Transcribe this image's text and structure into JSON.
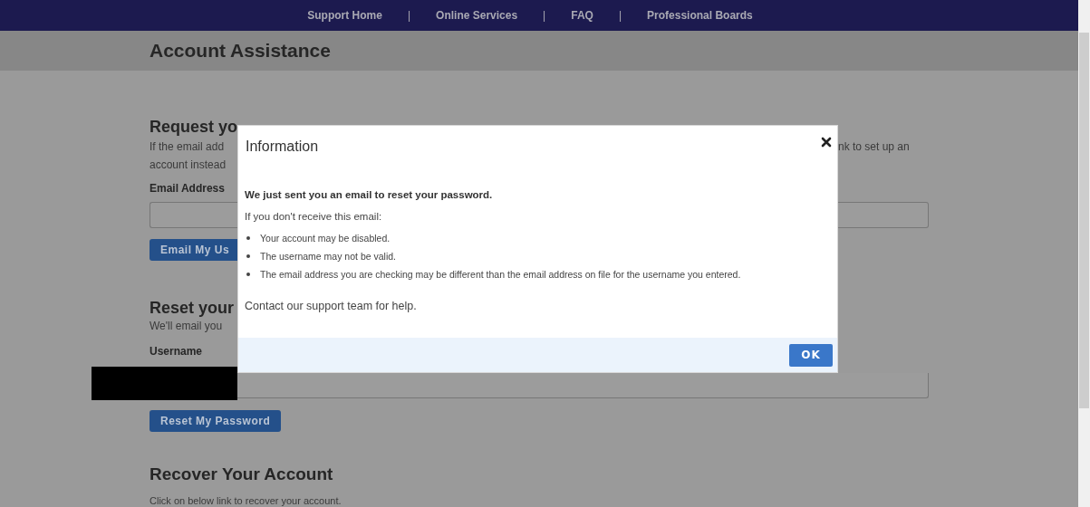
{
  "nav": [
    {
      "kind": "link",
      "label": "Support Home"
    },
    {
      "kind": "separator",
      "label": "|"
    },
    {
      "kind": "link",
      "label": "Online Services"
    },
    {
      "kind": "separator",
      "label": "|"
    },
    {
      "kind": "link",
      "label": "FAQ"
    },
    {
      "kind": "separator",
      "label": "|"
    },
    {
      "kind": "link",
      "label": "Professional Boards"
    }
  ],
  "page_title": "Account Assistance",
  "left_column": {
    "heading": "Request yo",
    "intro_lines": [
      "If the email add",
      "account instead"
    ],
    "email_label": "Email Address",
    "email_button": "Email My Us",
    "reset_heading": "Reset your",
    "reset_intro": "We'll email you",
    "username_label": "Username"
  },
  "right_column": {
    "intro_fragment": "nk to set up an"
  },
  "dialog": {
    "title": "Information",
    "message": "We just sent you an email to reset your password.",
    "lead": "If you don't receive this email:",
    "bullets": [
      "Your account may be disabled.",
      "The username may not be valid.",
      "The email address you are checking may be different than the email address on file for the username you entered."
    ],
    "contact": "Contact our support team for help.",
    "ok_button": "OK"
  },
  "reset_button": "Reset My Password",
  "recover": {
    "heading": "Recover Your Account",
    "text": "Click on below link to recover your account."
  }
}
